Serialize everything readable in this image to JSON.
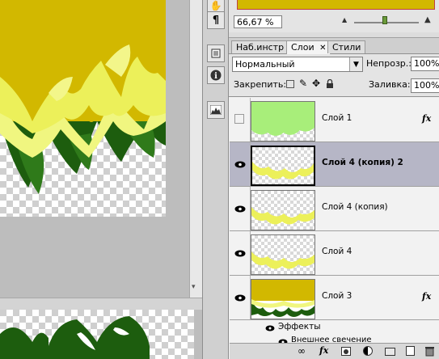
{
  "nav": {
    "zoom_value": "66,67 %"
  },
  "tabs": [
    {
      "label": "Наб.инстр",
      "active": false
    },
    {
      "label": "Слои",
      "active": true,
      "closable": true
    },
    {
      "label": "Стили",
      "active": false
    }
  ],
  "layers_panel": {
    "blend_mode": "Нормальный",
    "opacity_label": "Непрозр.:",
    "opacity_value": "100%",
    "lock_label": "Закрепить:",
    "fill_label": "Заливка:",
    "fill_value": "100%",
    "fx_label": "fx",
    "layers": [
      {
        "name": "Слой 1",
        "visible": false,
        "selected": false,
        "has_fx": true
      },
      {
        "name": "Слой 4 (копия) 2",
        "visible": true,
        "selected": true,
        "has_fx": false
      },
      {
        "name": "Слой 4 (копия)",
        "visible": true,
        "selected": false,
        "has_fx": false
      },
      {
        "name": "Слой 4",
        "visible": true,
        "selected": false,
        "has_fx": false
      },
      {
        "name": "Слой 3",
        "visible": true,
        "selected": false,
        "has_fx": true
      }
    ],
    "effects_label": "Эффекты",
    "effect_item": "Внешнее свечение"
  },
  "colors": {
    "ochre": "#d2b800",
    "pale_yellow": "#f0f680",
    "bright_yellow": "#ecf05a",
    "dark_green": "#1d5d0e",
    "light_green": "#a8ee7a",
    "selected_row": "#b6b6c6"
  },
  "icons": [
    "hand-tool-icon",
    "paragraph-icon",
    "notes-icon",
    "info-icon",
    "histogram-icon",
    "eye-icon",
    "lock-transparency-icon",
    "lock-paint-icon",
    "lock-move-icon",
    "lock-all-icon",
    "link-icon",
    "fx-icon",
    "mask-icon",
    "adjustment-icon",
    "group-icon",
    "new-layer-icon",
    "trash-icon"
  ]
}
